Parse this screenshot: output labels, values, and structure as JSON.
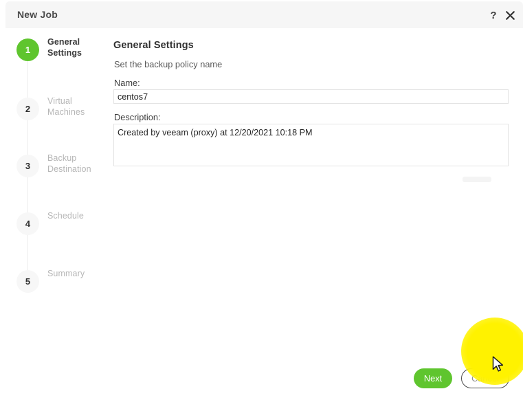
{
  "window": {
    "title": "New Job",
    "help_icon": "question-mark-icon",
    "close_icon": "close-x-icon"
  },
  "stepper": {
    "steps": [
      {
        "number": "1",
        "label": "General Settings",
        "active": true
      },
      {
        "number": "2",
        "label": "Virtual Machines",
        "active": false
      },
      {
        "number": "3",
        "label": "Backup Destination",
        "active": false
      },
      {
        "number": "4",
        "label": "Schedule",
        "active": false
      },
      {
        "number": "5",
        "label": "Summary",
        "active": false
      }
    ]
  },
  "main": {
    "heading": "General Settings",
    "subtitle": "Set the backup policy name",
    "name_label": "Name:",
    "name_value": "centos7",
    "name_placeholder": "",
    "description_label": "Description:",
    "description_value": "Created by veeam (proxy) at 12/20/2021 10:18 PM",
    "description_placeholder": ""
  },
  "footer": {
    "next_label": "Next",
    "cancel_label": "Cancel"
  },
  "colors": {
    "accent_green": "#5fc52e",
    "titlebar_bg": "#f6f6f6",
    "highlight_yellow": "#fff200",
    "input_border": "#e3e3e3",
    "inactive_step_text": "#b6b6b6"
  }
}
